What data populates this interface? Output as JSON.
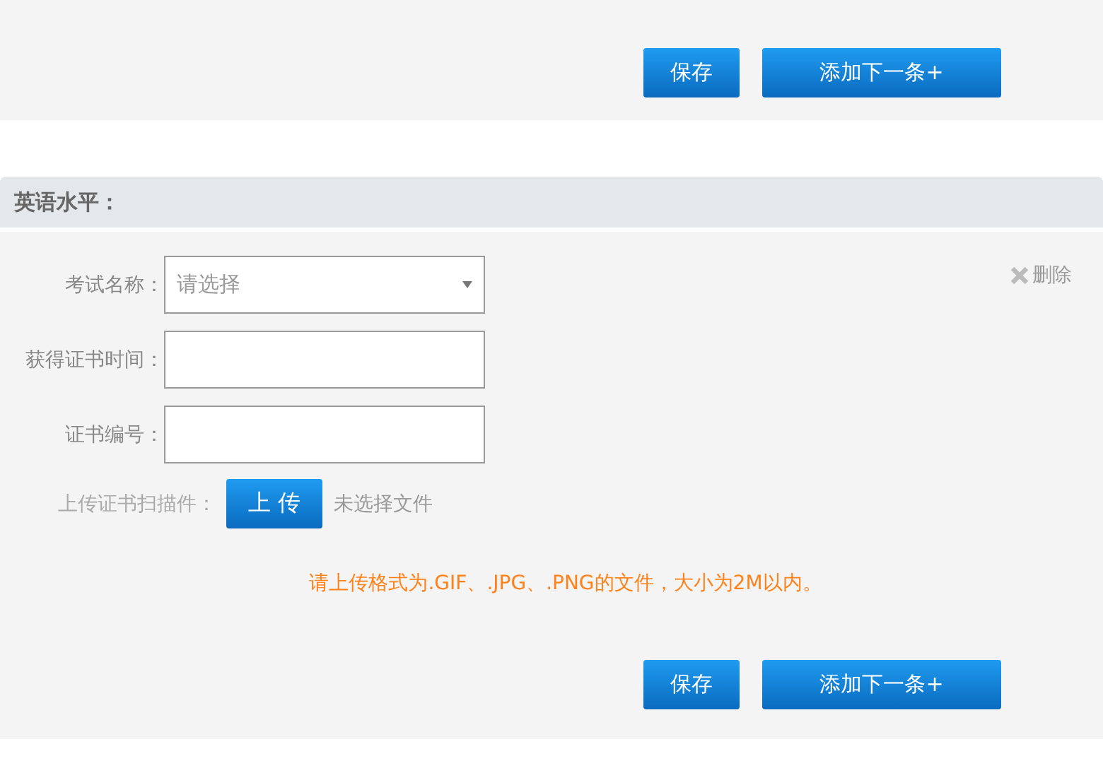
{
  "top_section": {
    "buttons": [
      {
        "label": "保存",
        "kind": "save"
      },
      {
        "label": "添加下一条+",
        "kind": "add"
      }
    ]
  },
  "english_section": {
    "title": "英语水平：",
    "delete": {
      "label": "删除"
    },
    "fields": [
      {
        "label": "考试名称：",
        "kind": "select",
        "placeholder": "请选择"
      },
      {
        "label": "获得证书时间：",
        "kind": "text"
      },
      {
        "label": "证书编号：",
        "kind": "text"
      }
    ],
    "upload": {
      "label": "上传证书扫描件：",
      "button": "上 传",
      "status": "未选择文件"
    },
    "hint": "请上传格式为.GIF、.JPG、.PNG的文件，大小为2M以内。",
    "buttons": [
      {
        "label": "保存",
        "kind": "save"
      },
      {
        "label": "添加下一条+",
        "kind": "add"
      }
    ]
  }
}
